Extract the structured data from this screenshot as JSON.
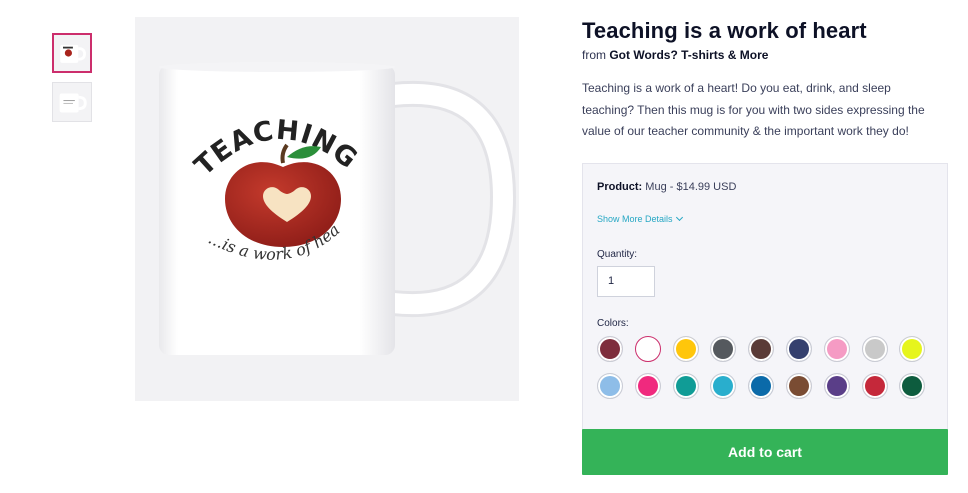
{
  "product": {
    "title": "Teaching is a work of heart",
    "from_prefix": "from",
    "shop_name": "Got Words? T-shirts & More",
    "description": "Teaching is a work of a heart! Do you eat, drink, and sleep teaching? Then this mug is for you with two sides expressing the value of our teacher community & the important work they do!",
    "image_text": {
      "top": "TEACHING",
      "bottom": "...is a work of heart"
    }
  },
  "options": {
    "product_label": "Product:",
    "product_value": "Mug - $14.99 USD",
    "show_more": "Show More Details",
    "quantity_label": "Quantity:",
    "quantity_value": "1",
    "colors_label": "Colors:",
    "colors": [
      "#7e2d3c",
      "#ffffff",
      "#ffc60b",
      "#55595e",
      "#5a3b37",
      "#35406e",
      "#f59bc4",
      "#c9c9c9",
      "#e6f51d",
      "#8ebde8",
      "#f0297e",
      "#109c96",
      "#29aecd",
      "#0b6aa9",
      "#7a4c33",
      "#5a3e88",
      "#c5283a",
      "#0d5c3e"
    ],
    "selected_color_index": 1
  },
  "actions": {
    "add_to_cart": "Add to cart"
  },
  "theme": {
    "accent": "#cc2e6c",
    "cart_green": "#34b358",
    "link": "#26a7c4"
  }
}
